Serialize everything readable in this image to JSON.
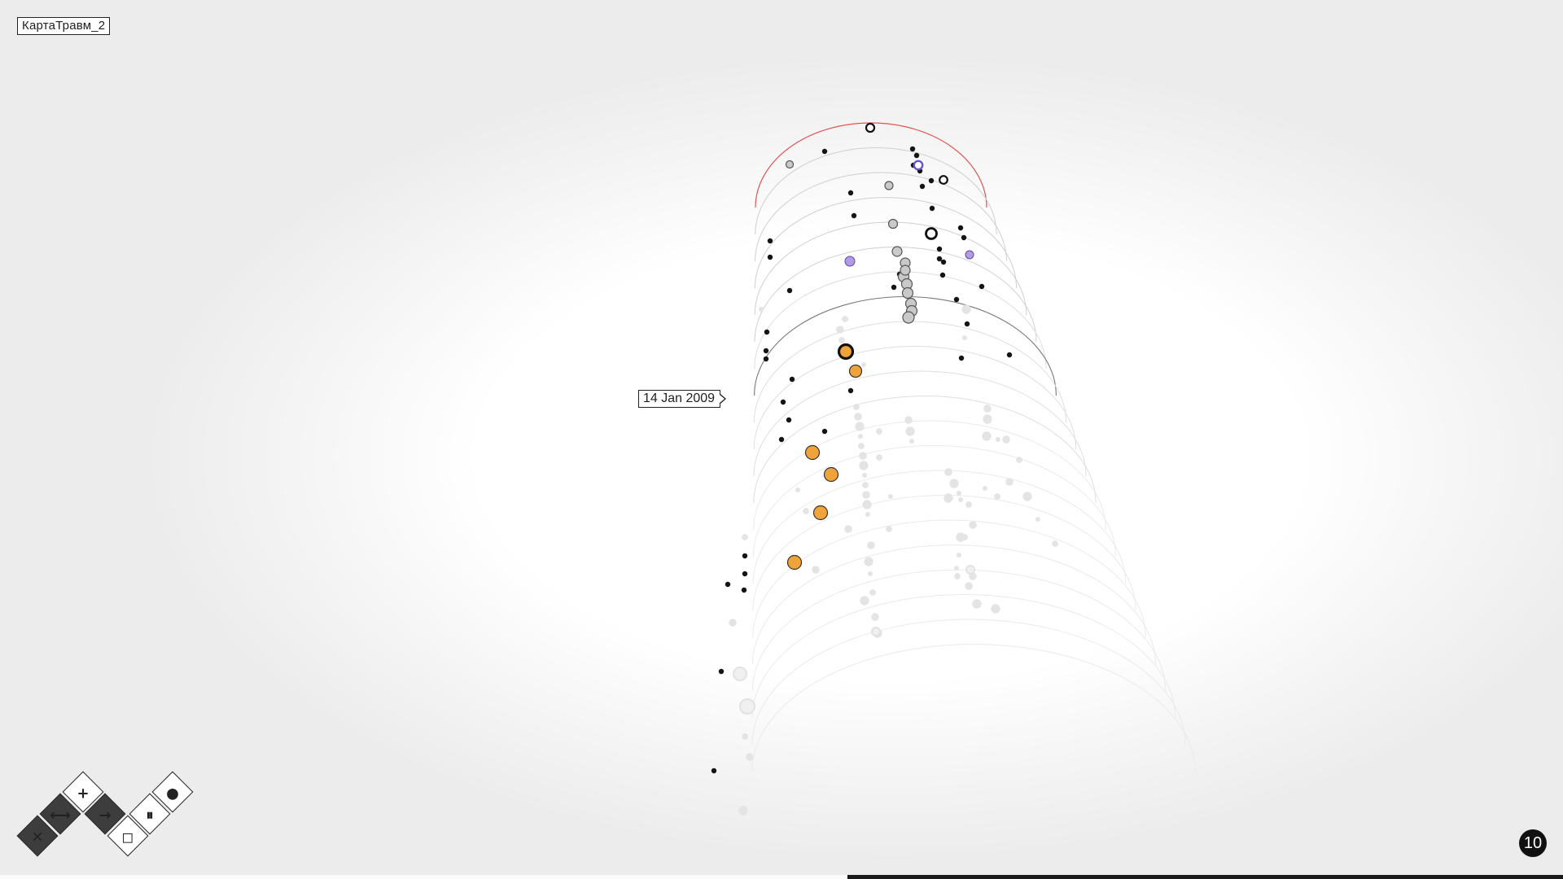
{
  "window": {
    "title": "КартаТравм_2"
  },
  "timeline": {
    "date_label": "14 Jan 2009"
  },
  "page": {
    "number": "10"
  },
  "progress": {
    "start_fraction": 0.542,
    "end_fraction": 1.0
  },
  "controls": [
    {
      "name": "close-button",
      "glyph": "✕",
      "style": "dark",
      "icon": "x-icon"
    },
    {
      "name": "range-button",
      "glyph": "⟷",
      "style": "dark",
      "icon": "range-arrows-icon"
    },
    {
      "name": "add-button",
      "glyph": "+",
      "style": "light",
      "icon": "plus-icon"
    },
    {
      "name": "forward-button",
      "glyph": "→",
      "style": "dark",
      "icon": "arrow-right-icon"
    },
    {
      "name": "stop-button",
      "glyph": "◻",
      "style": "light",
      "icon": "square-icon"
    },
    {
      "name": "pause-button",
      "glyph": "⏸",
      "style": "light",
      "icon": "pause-icon"
    },
    {
      "name": "drop-button",
      "glyph": "●",
      "style": "light",
      "icon": "drop-icon"
    }
  ],
  "colors": {
    "orange": "#f0a33b",
    "violet": "#b39be6",
    "violet_dark": "#6a52c9",
    "gray": "#c9c9c9",
    "black": "#141414",
    "faint": "#e4e4e4",
    "red_arc": "#e05555"
  }
}
